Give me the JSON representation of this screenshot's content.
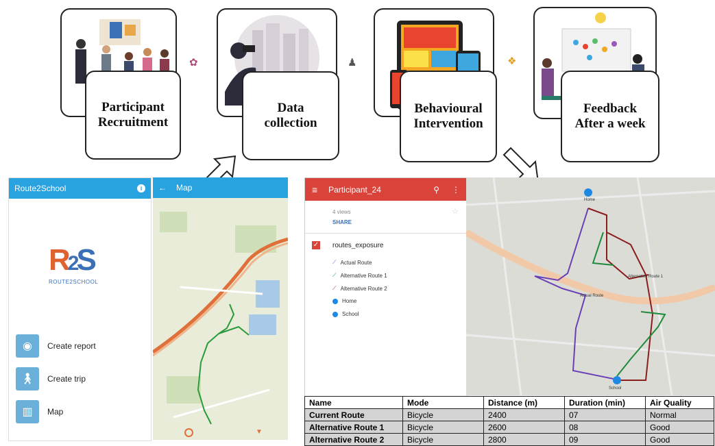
{
  "stages": [
    {
      "label": "Participant\nRecruitment"
    },
    {
      "label": "Data\ncollection"
    },
    {
      "label": "Behavioural\nIntervention"
    },
    {
      "label": "Feedback\nAfter a week"
    }
  ],
  "app": {
    "title": "Route2School",
    "info_icon": "info-icon",
    "logo_text": "ROUTE2SCHOOL",
    "menu": [
      {
        "label": "Create report",
        "icon": "camera-icon"
      },
      {
        "label": "Create trip",
        "icon": "walker-icon"
      },
      {
        "label": "Map",
        "icon": "map-icon"
      }
    ]
  },
  "map_screen": {
    "back_icon": "arrow-left-icon",
    "title": "Map"
  },
  "mymaps": {
    "title": "Participant_24",
    "views": "4 views",
    "share": "SHARE",
    "layer_name": "routes_exposure",
    "legend": [
      {
        "label": "Actual Route",
        "color": "#6a3fb5"
      },
      {
        "label": "Alternative Route 1",
        "color": "#1e8a3a"
      },
      {
        "label": "Alternative Route 2",
        "color": "#8a1e1e"
      },
      {
        "label": "Home",
        "color": "#1e88e5"
      },
      {
        "label": "School",
        "color": "#1e88e5"
      }
    ],
    "map_labels": {
      "home": "Home",
      "school": "School",
      "alt1": "Alternative Route 1",
      "actual": "Actual Route"
    }
  },
  "results_table": {
    "headers": [
      "Name",
      "Mode",
      "Distance (m)",
      "Duration (min)",
      "Air Quality"
    ],
    "rows": [
      [
        "Current Route",
        "Bicycle",
        "2400",
        "07",
        "Normal"
      ],
      [
        "Alternative Route  1",
        "Bicycle",
        "2600",
        "08",
        "Good"
      ],
      [
        "Alternative Route  2",
        "Bicycle",
        "2800",
        "09",
        "Good"
      ]
    ]
  }
}
